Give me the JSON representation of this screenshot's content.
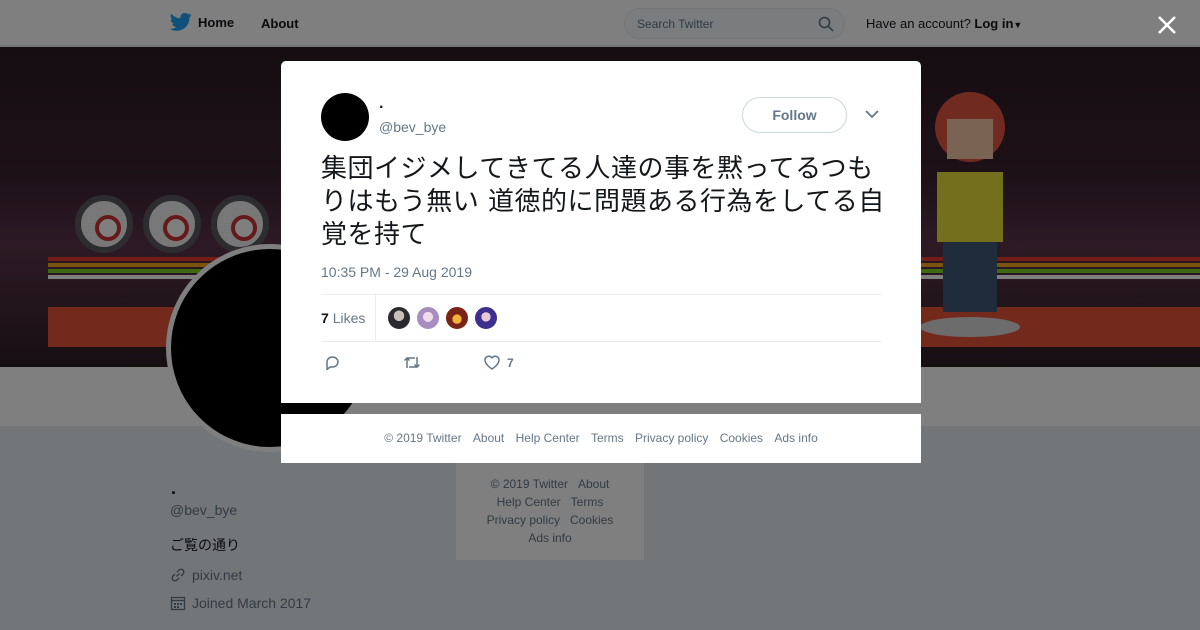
{
  "topbar": {
    "home_label": "Home",
    "about_label": "About",
    "search_placeholder": "Search Twitter",
    "have_account": "Have an account?",
    "login_label": "Log in"
  },
  "profile": {
    "name": ".",
    "handle": "@bev_bye",
    "bio": "ご覧の通り",
    "link": "pixiv.net",
    "joined": "Joined March 2017"
  },
  "side_footer": {
    "links": [
      "© 2019 Twitter",
      "About",
      "Help Center",
      "Terms",
      "Privacy policy",
      "Cookies",
      "Ads info"
    ]
  },
  "tweet": {
    "name": ".",
    "handle": "@bev_bye",
    "follow_label": "Follow",
    "text": "集団イジメしてきてる人達の事を黙ってるつもりはもう無い 道徳的に問題ある行為をしてる自覚を持て",
    "timestamp": "10:35 PM - 29 Aug 2019",
    "likes_count": "7",
    "likes_label": "Likes",
    "like_action_count": "7"
  },
  "modal_footer": {
    "links": [
      "© 2019 Twitter",
      "About",
      "Help Center",
      "Terms",
      "Privacy policy",
      "Cookies",
      "Ads info"
    ]
  },
  "colors": {
    "brand": "#1da1f2",
    "muted": "#657786",
    "text": "#14171a"
  },
  "icons": {
    "logo": "twitter-bird-icon",
    "search": "search-icon",
    "close": "close-icon",
    "reply": "reply-icon",
    "retweet": "retweet-icon",
    "like": "heart-icon",
    "link": "link-icon",
    "calendar": "calendar-icon"
  }
}
